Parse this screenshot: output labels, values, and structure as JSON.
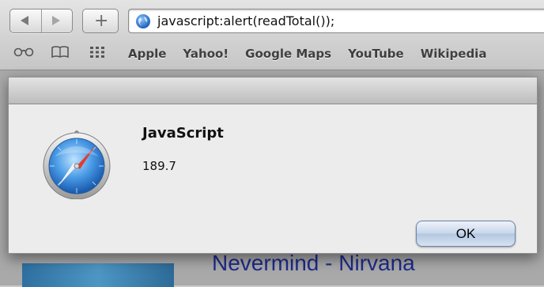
{
  "toolbar": {
    "address": "javascript:alert(readTotal());",
    "bookmarks": [
      "Apple",
      "Yahoo!",
      "Google Maps",
      "YouTube",
      "Wikipedia"
    ]
  },
  "page": {
    "background_title": "Nevermind - Nirvana"
  },
  "dialog": {
    "title": "JavaScript",
    "message": "189.7",
    "ok_label": "OK"
  },
  "icons": [
    "back-icon",
    "forward-icon",
    "plus-icon",
    "globe-icon",
    "reading-list-icon",
    "bookmarks-book-icon",
    "top-sites-grid-icon",
    "safari-compass-icon"
  ],
  "colors": {
    "accent_button": "#b4c7e1",
    "dialog_bg": "#ececec"
  }
}
